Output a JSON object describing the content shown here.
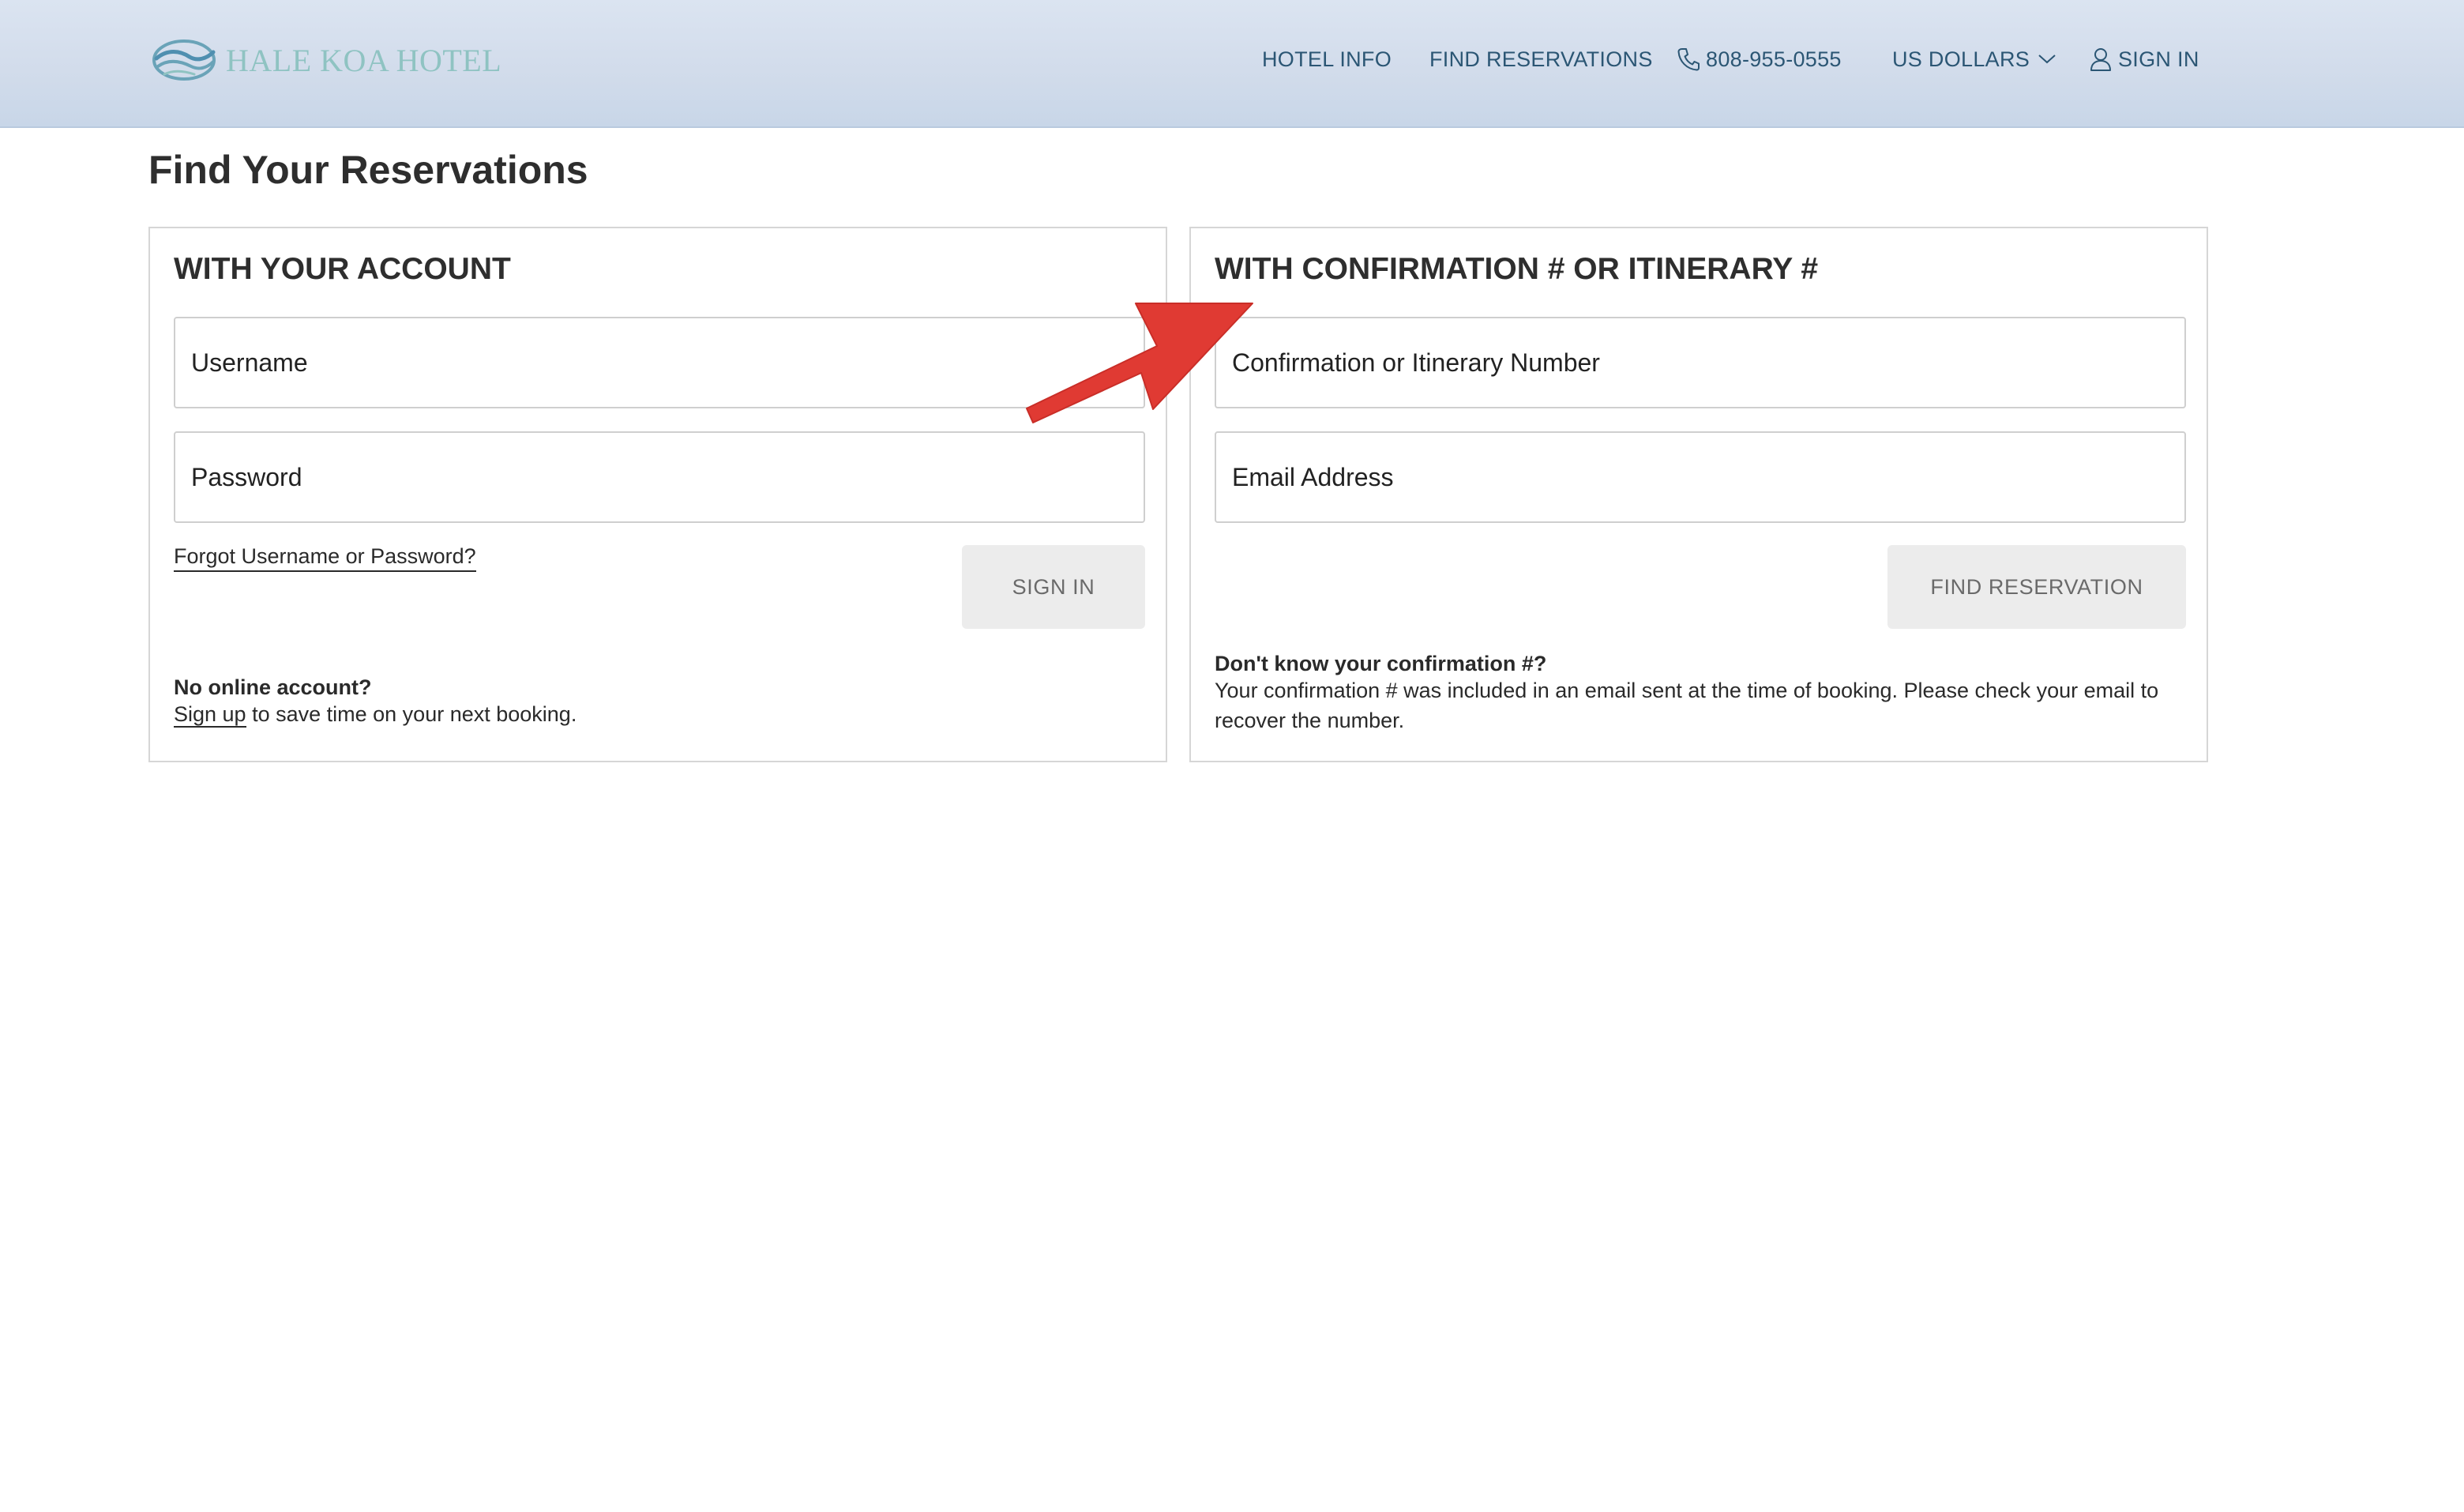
{
  "header": {
    "brand": "HALE KOA HOTEL",
    "nav": {
      "hotel_info": "HOTEL INFO",
      "find_reservations": "FIND RESERVATIONS",
      "phone": "808-955-0555",
      "currency": "US DOLLARS",
      "sign_in": "SIGN IN"
    }
  },
  "page": {
    "title": "Find Your Reservations"
  },
  "account_panel": {
    "heading": "WITH YOUR ACCOUNT",
    "username_placeholder": "Username",
    "password_placeholder": "Password",
    "forgot_link": "Forgot Username or Password?",
    "sign_in_button": "SIGN IN",
    "no_account_heading": "No online account?",
    "sign_up_link": "Sign up",
    "sign_up_suffix": " to save time on your next booking."
  },
  "confirmation_panel": {
    "heading": "WITH CONFIRMATION # OR ITINERARY #",
    "confirmation_placeholder": "Confirmation or Itinerary Number",
    "email_placeholder": "Email Address",
    "find_button": "FIND RESERVATION",
    "help_heading": "Don't know your confirmation #?",
    "help_text": "Your confirmation # was included in an email sent at the time of booking. Please check your email to recover the number."
  },
  "colors": {
    "header_bg": "#d2dceb",
    "nav_text": "#2b5674",
    "logo_text": "#8fc3c2",
    "annotation_arrow": "#e03a33",
    "button_bg": "#ececec"
  },
  "icons": {
    "logo": "wave-logo-icon",
    "phone": "phone-icon",
    "currency_dropdown": "chevron-down-icon",
    "sign_in": "user-icon"
  }
}
